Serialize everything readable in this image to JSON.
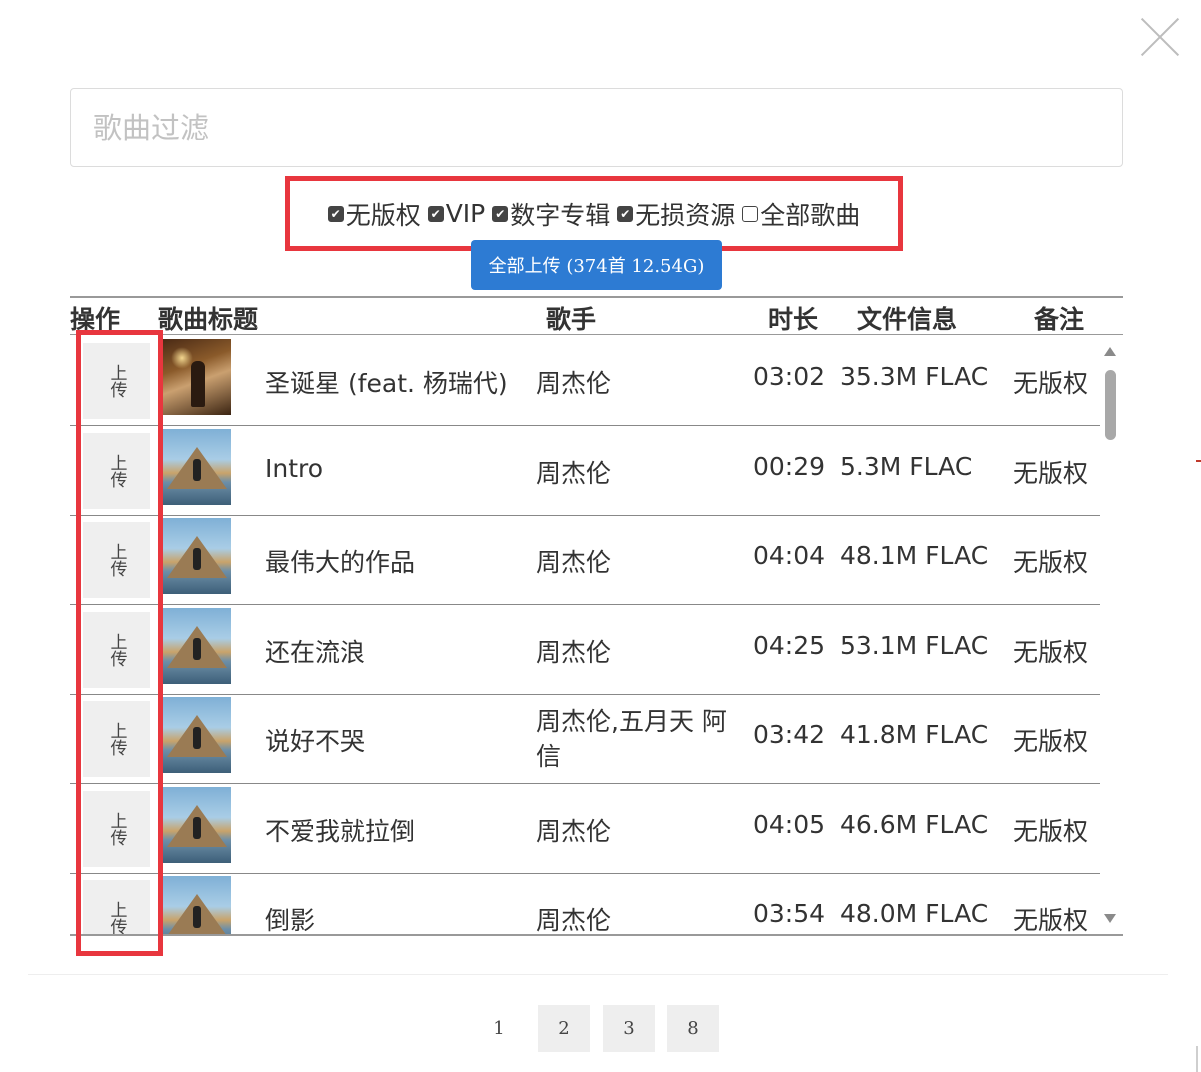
{
  "filter": {
    "placeholder": "歌曲过滤"
  },
  "options": [
    {
      "label": "无版权",
      "checked": true
    },
    {
      "label": "VIP",
      "checked": true
    },
    {
      "label": "数字专辑",
      "checked": true
    },
    {
      "label": "无损资源",
      "checked": true
    },
    {
      "label": "全部歌曲",
      "checked": false
    }
  ],
  "upload_all_label": "全部上传 (374首 12.54G)",
  "columns": {
    "action": "操作",
    "title": "歌曲标题",
    "artist": "歌手",
    "duration": "时长",
    "file_info": "文件信息",
    "note": "备注"
  },
  "rows": [
    {
      "upload": "上传",
      "cover": "album-cover-christmas-icon",
      "title": "圣诞星 (feat. 杨瑞代)",
      "artist": "周杰伦",
      "duration": "03:02",
      "file_info": "35.3M FLAC",
      "note": "无版权"
    },
    {
      "upload": "上传",
      "cover": "album-cover-icon",
      "title": "Intro",
      "artist": "周杰伦",
      "duration": "00:29",
      "file_info": "5.3M FLAC",
      "note": "无版权"
    },
    {
      "upload": "上传",
      "cover": "album-cover-icon",
      "title": "最伟大的作品",
      "artist": "周杰伦",
      "duration": "04:04",
      "file_info": "48.1M FLAC",
      "note": "无版权"
    },
    {
      "upload": "上传",
      "cover": "album-cover-icon",
      "title": "还在流浪",
      "artist": "周杰伦",
      "duration": "04:25",
      "file_info": "53.1M FLAC",
      "note": "无版权"
    },
    {
      "upload": "上传",
      "cover": "album-cover-icon",
      "title": "说好不哭",
      "artist": "周杰伦,五月天 阿信",
      "duration": "03:42",
      "file_info": "41.8M FLAC",
      "note": "无版权"
    },
    {
      "upload": "上传",
      "cover": "album-cover-icon",
      "title": "不爱我就拉倒",
      "artist": "周杰伦",
      "duration": "04:05",
      "file_info": "46.6M FLAC",
      "note": "无版权"
    },
    {
      "upload": "上传",
      "cover": "album-cover-icon",
      "title": "倒影",
      "artist": "周杰伦",
      "duration": "03:54",
      "file_info": "48.0M FLAC",
      "note": "无版权"
    }
  ],
  "pagination": {
    "pages": [
      "1",
      "2",
      "3",
      "8"
    ],
    "current": "1"
  },
  "colors": {
    "accent": "#2d7bd3",
    "highlight": "#e8363e"
  }
}
